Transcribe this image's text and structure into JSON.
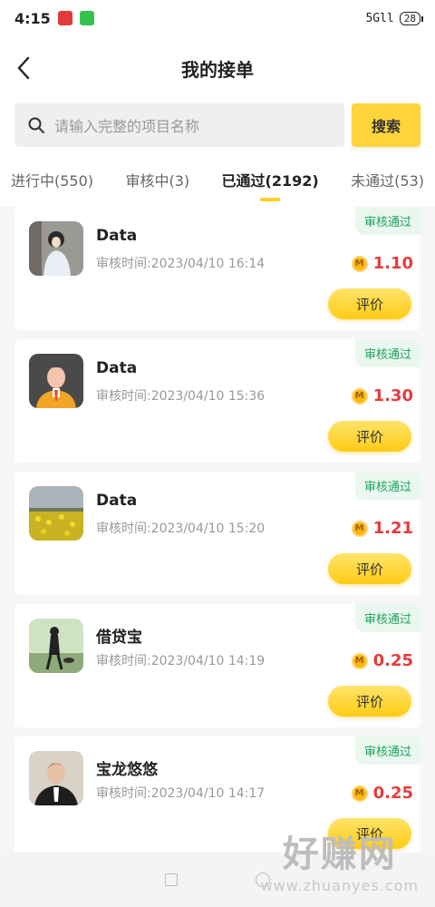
{
  "status": {
    "time": "4:15",
    "signal": "5Gll",
    "battery": "28"
  },
  "header": {
    "title": "我的接单"
  },
  "search": {
    "placeholder": "请输入完整的项目名称",
    "button_label": "搜索"
  },
  "tabs": [
    {
      "label": "进行中(550)",
      "active": false
    },
    {
      "label": "审核中(3)",
      "active": false
    },
    {
      "label": "已通过(2192)",
      "active": true
    },
    {
      "label": "未通过(53)",
      "active": false
    }
  ],
  "orders": [
    {
      "title": "Data",
      "time": "审核时间:2023/04/10 16:14",
      "status": "审核通过",
      "amount": "1.10",
      "button": "评价"
    },
    {
      "title": "Data",
      "time": "审核时间:2023/04/10 15:36",
      "status": "审核通过",
      "amount": "1.30",
      "button": "评价"
    },
    {
      "title": "Data",
      "time": "审核时间:2023/04/10 15:20",
      "status": "审核通过",
      "amount": "1.21",
      "button": "评价"
    },
    {
      "title": "借贷宝",
      "time": "审核时间:2023/04/10 14:19",
      "status": "审核通过",
      "amount": "0.25",
      "button": "评价"
    },
    {
      "title": "宝龙悠悠",
      "time": "审核时间:2023/04/10 14:17",
      "status": "审核通过",
      "amount": "0.25",
      "button": "评价"
    }
  ],
  "coin_symbol": "M",
  "watermark": {
    "main": "好赚网",
    "sub": "www.zhuanyes.com"
  },
  "colors": {
    "accent": "#ffd43b",
    "amount": "#e63c3c",
    "badge_text": "#1fa25c",
    "badge_bg": "#eaf7ef"
  }
}
